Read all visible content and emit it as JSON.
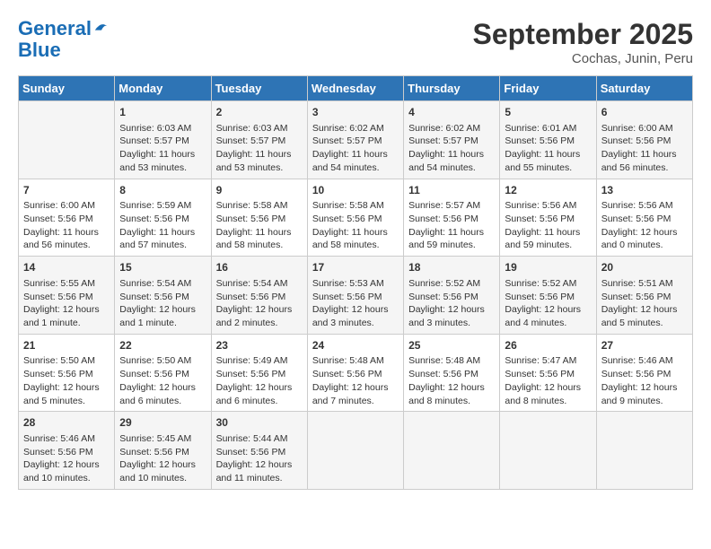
{
  "logo": {
    "line1": "General",
    "line2": "Blue"
  },
  "title": "September 2025",
  "subtitle": "Cochas, Junin, Peru",
  "headers": [
    "Sunday",
    "Monday",
    "Tuesday",
    "Wednesday",
    "Thursday",
    "Friday",
    "Saturday"
  ],
  "weeks": [
    [
      {
        "day": "",
        "info": ""
      },
      {
        "day": "1",
        "info": "Sunrise: 6:03 AM\nSunset: 5:57 PM\nDaylight: 11 hours\nand 53 minutes."
      },
      {
        "day": "2",
        "info": "Sunrise: 6:03 AM\nSunset: 5:57 PM\nDaylight: 11 hours\nand 53 minutes."
      },
      {
        "day": "3",
        "info": "Sunrise: 6:02 AM\nSunset: 5:57 PM\nDaylight: 11 hours\nand 54 minutes."
      },
      {
        "day": "4",
        "info": "Sunrise: 6:02 AM\nSunset: 5:57 PM\nDaylight: 11 hours\nand 54 minutes."
      },
      {
        "day": "5",
        "info": "Sunrise: 6:01 AM\nSunset: 5:56 PM\nDaylight: 11 hours\nand 55 minutes."
      },
      {
        "day": "6",
        "info": "Sunrise: 6:00 AM\nSunset: 5:56 PM\nDaylight: 11 hours\nand 56 minutes."
      }
    ],
    [
      {
        "day": "7",
        "info": "Sunrise: 6:00 AM\nSunset: 5:56 PM\nDaylight: 11 hours\nand 56 minutes."
      },
      {
        "day": "8",
        "info": "Sunrise: 5:59 AM\nSunset: 5:56 PM\nDaylight: 11 hours\nand 57 minutes."
      },
      {
        "day": "9",
        "info": "Sunrise: 5:58 AM\nSunset: 5:56 PM\nDaylight: 11 hours\nand 58 minutes."
      },
      {
        "day": "10",
        "info": "Sunrise: 5:58 AM\nSunset: 5:56 PM\nDaylight: 11 hours\nand 58 minutes."
      },
      {
        "day": "11",
        "info": "Sunrise: 5:57 AM\nSunset: 5:56 PM\nDaylight: 11 hours\nand 59 minutes."
      },
      {
        "day": "12",
        "info": "Sunrise: 5:56 AM\nSunset: 5:56 PM\nDaylight: 11 hours\nand 59 minutes."
      },
      {
        "day": "13",
        "info": "Sunrise: 5:56 AM\nSunset: 5:56 PM\nDaylight: 12 hours\nand 0 minutes."
      }
    ],
    [
      {
        "day": "14",
        "info": "Sunrise: 5:55 AM\nSunset: 5:56 PM\nDaylight: 12 hours\nand 1 minute."
      },
      {
        "day": "15",
        "info": "Sunrise: 5:54 AM\nSunset: 5:56 PM\nDaylight: 12 hours\nand 1 minute."
      },
      {
        "day": "16",
        "info": "Sunrise: 5:54 AM\nSunset: 5:56 PM\nDaylight: 12 hours\nand 2 minutes."
      },
      {
        "day": "17",
        "info": "Sunrise: 5:53 AM\nSunset: 5:56 PM\nDaylight: 12 hours\nand 3 minutes."
      },
      {
        "day": "18",
        "info": "Sunrise: 5:52 AM\nSunset: 5:56 PM\nDaylight: 12 hours\nand 3 minutes."
      },
      {
        "day": "19",
        "info": "Sunrise: 5:52 AM\nSunset: 5:56 PM\nDaylight: 12 hours\nand 4 minutes."
      },
      {
        "day": "20",
        "info": "Sunrise: 5:51 AM\nSunset: 5:56 PM\nDaylight: 12 hours\nand 5 minutes."
      }
    ],
    [
      {
        "day": "21",
        "info": "Sunrise: 5:50 AM\nSunset: 5:56 PM\nDaylight: 12 hours\nand 5 minutes."
      },
      {
        "day": "22",
        "info": "Sunrise: 5:50 AM\nSunset: 5:56 PM\nDaylight: 12 hours\nand 6 minutes."
      },
      {
        "day": "23",
        "info": "Sunrise: 5:49 AM\nSunset: 5:56 PM\nDaylight: 12 hours\nand 6 minutes."
      },
      {
        "day": "24",
        "info": "Sunrise: 5:48 AM\nSunset: 5:56 PM\nDaylight: 12 hours\nand 7 minutes."
      },
      {
        "day": "25",
        "info": "Sunrise: 5:48 AM\nSunset: 5:56 PM\nDaylight: 12 hours\nand 8 minutes."
      },
      {
        "day": "26",
        "info": "Sunrise: 5:47 AM\nSunset: 5:56 PM\nDaylight: 12 hours\nand 8 minutes."
      },
      {
        "day": "27",
        "info": "Sunrise: 5:46 AM\nSunset: 5:56 PM\nDaylight: 12 hours\nand 9 minutes."
      }
    ],
    [
      {
        "day": "28",
        "info": "Sunrise: 5:46 AM\nSunset: 5:56 PM\nDaylight: 12 hours\nand 10 minutes."
      },
      {
        "day": "29",
        "info": "Sunrise: 5:45 AM\nSunset: 5:56 PM\nDaylight: 12 hours\nand 10 minutes."
      },
      {
        "day": "30",
        "info": "Sunrise: 5:44 AM\nSunset: 5:56 PM\nDaylight: 12 hours\nand 11 minutes."
      },
      {
        "day": "",
        "info": ""
      },
      {
        "day": "",
        "info": ""
      },
      {
        "day": "",
        "info": ""
      },
      {
        "day": "",
        "info": ""
      }
    ]
  ]
}
